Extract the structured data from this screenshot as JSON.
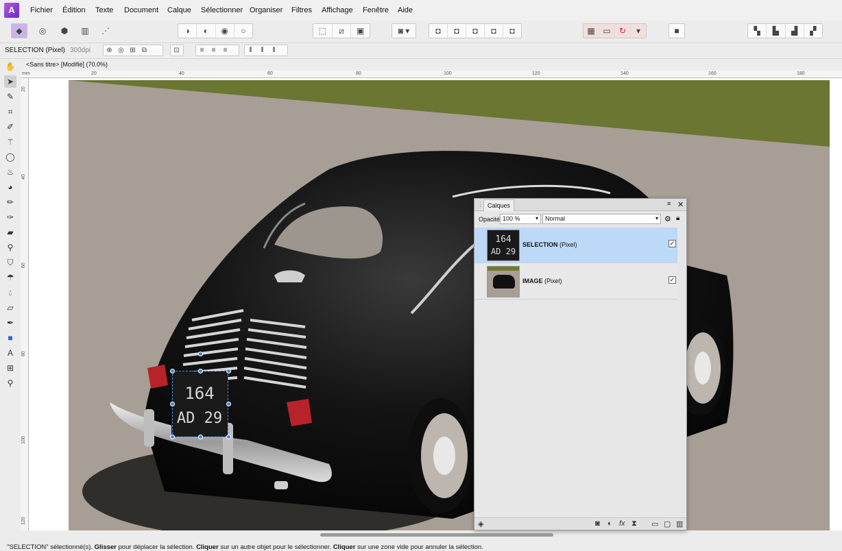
{
  "menu": {
    "items": [
      "Fichier",
      "Édition",
      "Texte",
      "Document",
      "Calque",
      "Sélectionner",
      "Organiser",
      "Filtres",
      "Affichage",
      "Fenêtre",
      "Aide"
    ]
  },
  "context": {
    "label": "SELECTION (Pixel)",
    "dpi": "300dpi"
  },
  "document": {
    "title": "<Sans titre> [Modifié] (70.0%)"
  },
  "ruler": {
    "unit": "mm",
    "top_ticks": [
      "20",
      "40",
      "60",
      "80",
      "100",
      "120",
      "140",
      "160",
      "180"
    ],
    "left_ticks": [
      "20",
      "40",
      "60",
      "80",
      "100",
      "120"
    ]
  },
  "plate": {
    "line1": "164",
    "line2": "AD 29"
  },
  "layers_panel": {
    "tab": "Calques",
    "opacity_label": "Opacité:",
    "opacity_value": "100 %",
    "blend_mode": "Normal",
    "layers": [
      {
        "name": "SELECTION",
        "type": "(Pixel)",
        "selected": true,
        "visible": true
      },
      {
        "name": "IMAGE",
        "type": "(Pixel)",
        "selected": false,
        "visible": true
      }
    ]
  },
  "status": {
    "parts": [
      "\"SELECTION\" sélectionné(s). ",
      "Glisser",
      " pour déplacer la sélection. ",
      "Cliquer",
      " sur un autre objet pour le sélectionner. ",
      "Cliquer",
      " sur une zone vide pour annuler la sélection."
    ]
  },
  "colors": {
    "selection_row": "#bcd9f7",
    "accent": "#3b86e6",
    "road": "#a79e96",
    "grass": "#6e7a34",
    "car": "#111111"
  },
  "icons": [
    "hand-icon",
    "move-icon",
    "eyedropper-icon",
    "crop-icon",
    "brush-icon",
    "wand-icon",
    "lasso-icon",
    "fill-icon",
    "color-icon",
    "paint-icon",
    "retouch-icon",
    "bandage-icon",
    "zoom-icon",
    "stamp-icon",
    "smudge-icon",
    "drop-icon",
    "eraser-icon",
    "pen-icon",
    "rect-icon",
    "text-icon",
    "mesh-icon",
    "search-icon"
  ]
}
